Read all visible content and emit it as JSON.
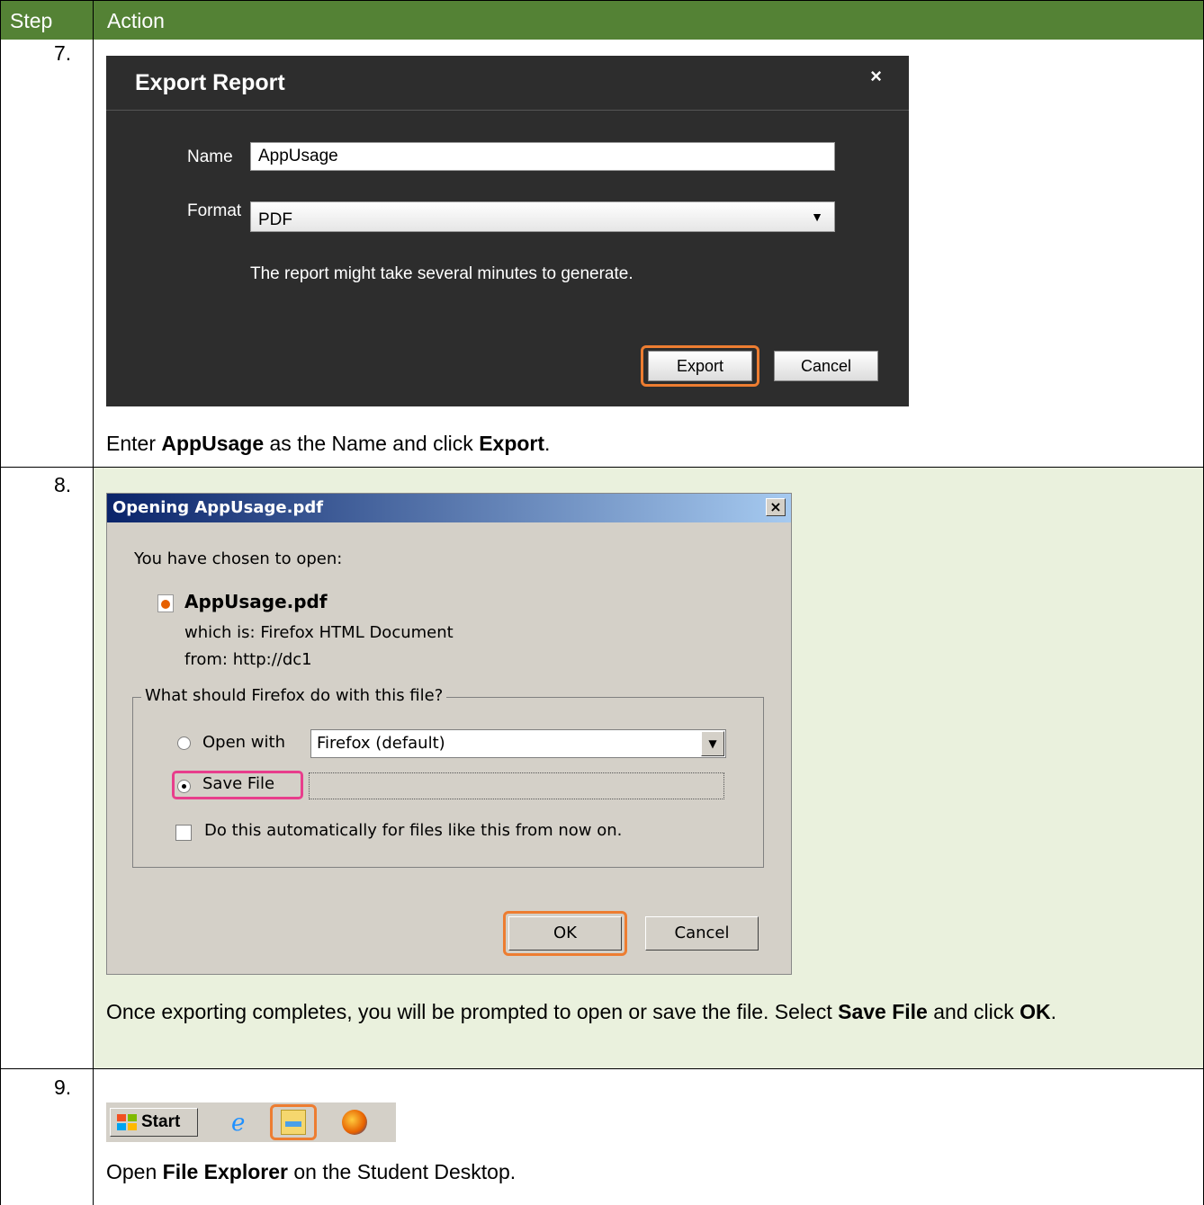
{
  "table": {
    "headers": [
      "Step",
      "Action"
    ],
    "rows": [
      {
        "step": "7.",
        "instruction": {
          "pre": "Enter ",
          "b1": "AppUsage",
          "mid": " as the Name and click ",
          "b2": "Export",
          "post": "."
        }
      },
      {
        "step": "8.",
        "instruction": {
          "pre": "Once exporting completes, you will be prompted to open or save the file. Select ",
          "b1": "Save File",
          "mid": " and click ",
          "b2": "OK",
          "post": "."
        }
      },
      {
        "step": "9.",
        "instruction": {
          "pre": "Open ",
          "b1": "File Explorer",
          "mid": " on the Student Desktop.",
          "b2": "",
          "post": ""
        }
      }
    ]
  },
  "export_dialog": {
    "title": "Export Report",
    "close": "×",
    "name_label": "Name",
    "name_value": "AppUsage",
    "format_label": "Format",
    "format_value": "PDF",
    "note": "The report might take several minutes to generate.",
    "export_button": "Export",
    "cancel_button": "Cancel"
  },
  "firefox_dialog": {
    "title": "Opening AppUsage.pdf",
    "close": "×",
    "chosen_text": "You have chosen to open:",
    "file_name": "AppUsage.pdf",
    "which_is_label": "which is:",
    "which_is_value": "Firefox HTML Document",
    "from_label": "from:",
    "from_value": "http://dc1",
    "group_legend": "What should Firefox do with this file?",
    "open_with_label": "Open with",
    "open_with_value": "Firefox (default)",
    "save_file_label": "Save File",
    "auto_checkbox_label": "Do this automatically for files like this from now on.",
    "ok_button": "OK",
    "cancel_button": "Cancel"
  },
  "taskbar": {
    "start_label": "Start",
    "icons": [
      "windows-logo-icon",
      "internet-explorer-icon",
      "file-explorer-icon",
      "firefox-icon"
    ]
  },
  "colors": {
    "header_bg": "#548235",
    "step8_bg": "#eaf1dd",
    "highlight_orange": "#ed7d31",
    "highlight_pink": "#e83e8c"
  }
}
